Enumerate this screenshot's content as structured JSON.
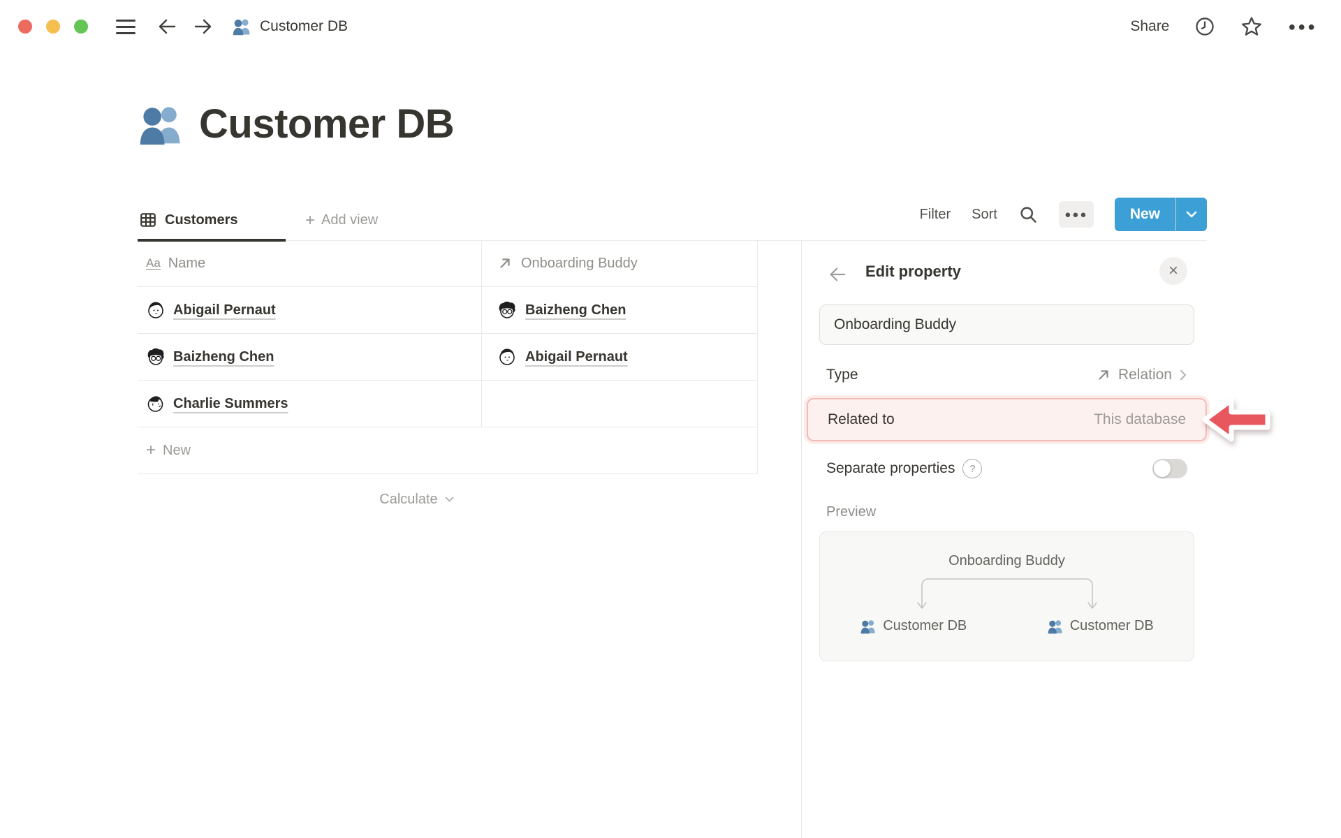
{
  "topbar": {
    "breadcrumb": "Customer DB",
    "share_label": "Share"
  },
  "page": {
    "title": "Customer DB"
  },
  "viewbar": {
    "tab_label": "Customers",
    "add_view_label": "Add view",
    "filter_label": "Filter",
    "sort_label": "Sort",
    "new_label": "New"
  },
  "table": {
    "columns": [
      {
        "label": "Name"
      },
      {
        "label": "Onboarding Buddy"
      }
    ],
    "rows": [
      {
        "name": "Abigail Pernaut",
        "buddy": "Baizheng Chen"
      },
      {
        "name": "Baizheng Chen",
        "buddy": "Abigail Pernaut"
      },
      {
        "name": "Charlie Summers",
        "buddy": ""
      }
    ],
    "new_row_label": "New",
    "calculate_label": "Calculate"
  },
  "panel": {
    "title": "Edit property",
    "name_value": "Onboarding Buddy",
    "type_label": "Type",
    "type_value": "Relation",
    "related_label": "Related to",
    "related_value": "This database",
    "separate_label": "Separate properties",
    "preview_label": "Preview",
    "preview_title": "Onboarding Buddy",
    "preview_items": [
      "Customer DB",
      "Customer DB"
    ]
  },
  "icons": {
    "aa": "Aa",
    "plus": "+",
    "more": "●●●",
    "close": "×",
    "question": "?"
  },
  "colors": {
    "accent_blue": "#3CA0D6",
    "highlight_bg": "#FDF1F0",
    "highlight_border": "#F2BCB7",
    "arrow_red": "#E9575E",
    "divider": "#E9E9E7"
  }
}
